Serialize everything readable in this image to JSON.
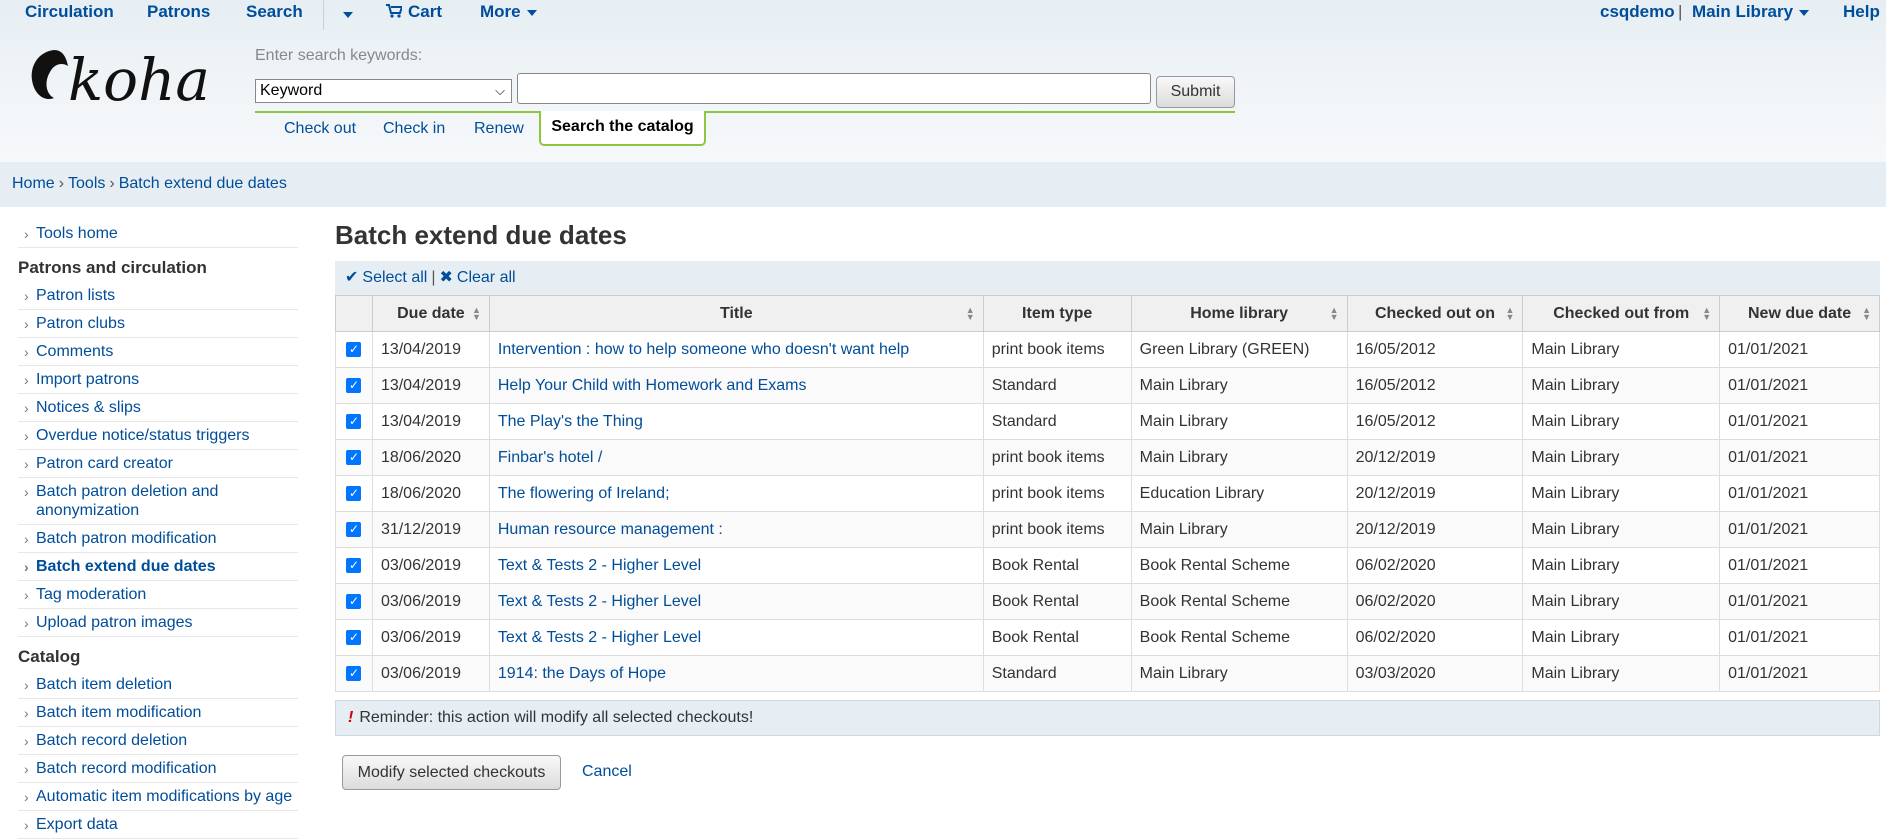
{
  "topnav": {
    "circulation": "Circulation",
    "patrons": "Patrons",
    "search": "Search",
    "cart": "Cart",
    "more": "More",
    "user": "csqdemo",
    "library": "Main Library",
    "help": "Help",
    "divider": "|"
  },
  "logo": {
    "text": "koha"
  },
  "search": {
    "label": "Enter search keywords:",
    "select_value": "Keyword",
    "input_value": "",
    "submit": "Submit",
    "tabs": [
      "Check out",
      "Check in",
      "Renew",
      "Search the catalog"
    ]
  },
  "breadcrumb": [
    "Home",
    "Tools",
    "Batch extend due dates"
  ],
  "sidebar": {
    "top_item": "Tools home",
    "sections": [
      {
        "heading": "Patrons and circulation",
        "items": [
          "Patron lists",
          "Patron clubs",
          "Comments",
          "Import patrons",
          "Notices & slips",
          "Overdue notice/status triggers",
          "Patron card creator",
          "Batch patron deletion and anonymization",
          "Batch patron modification",
          "Batch extend due dates",
          "Tag moderation",
          "Upload patron images"
        ]
      },
      {
        "heading": "Catalog",
        "items": [
          "Batch item deletion",
          "Batch item modification",
          "Batch record deletion",
          "Batch record modification",
          "Automatic item modifications by age",
          "Export data"
        ]
      }
    ],
    "active": "Batch extend due dates"
  },
  "main": {
    "title": "Batch extend due dates",
    "select_all": "Select all",
    "clear_all": "Clear all",
    "columns": [
      "Due date",
      "Title",
      "Item type",
      "Home library",
      "Checked out on",
      "Checked out from",
      "New due date"
    ],
    "rows": [
      [
        "13/04/2019",
        "Intervention : how to help someone who doesn't want help",
        "print book items",
        "Green Library (GREEN)",
        "16/05/2012",
        "Main Library",
        "01/01/2021"
      ],
      [
        "13/04/2019",
        "Help Your Child with Homework and Exams",
        "Standard",
        "Main Library",
        "16/05/2012",
        "Main Library",
        "01/01/2021"
      ],
      [
        "13/04/2019",
        "The Play's the Thing",
        "Standard",
        "Main Library",
        "16/05/2012",
        "Main Library",
        "01/01/2021"
      ],
      [
        "18/06/2020",
        "Finbar's hotel /",
        "print book items",
        "Main Library",
        "20/12/2019",
        "Main Library",
        "01/01/2021"
      ],
      [
        "18/06/2020",
        "The flowering of Ireland;",
        "print book items",
        "Education Library",
        "20/12/2019",
        "Main Library",
        "01/01/2021"
      ],
      [
        "31/12/2019",
        "Human resource management :",
        "print book items",
        "Main Library",
        "20/12/2019",
        "Main Library",
        "01/01/2021"
      ],
      [
        "03/06/2019",
        "Text & Tests 2 - Higher Level",
        "Book Rental",
        "Book Rental Scheme",
        "06/02/2020",
        "Main Library",
        "01/01/2021"
      ],
      [
        "03/06/2019",
        "Text & Tests 2 - Higher Level",
        "Book Rental",
        "Book Rental Scheme",
        "06/02/2020",
        "Main Library",
        "01/01/2021"
      ],
      [
        "03/06/2019",
        "Text & Tests 2 - Higher Level",
        "Book Rental",
        "Book Rental Scheme",
        "06/02/2020",
        "Main Library",
        "01/01/2021"
      ],
      [
        "03/06/2019",
        "1914: the Days of Hope",
        "Standard",
        "Main Library",
        "03/03/2020",
        "Main Library",
        "01/01/2021"
      ]
    ],
    "reminder": "Reminder: this action will modify all selected checkouts!",
    "modify_button": "Modify selected checkouts",
    "cancel": "Cancel"
  },
  "colors": {
    "link": "#004d99",
    "accent_green": "#8dc63f",
    "header_bg": "#e6eef3",
    "checkbox": "#0075ff"
  }
}
